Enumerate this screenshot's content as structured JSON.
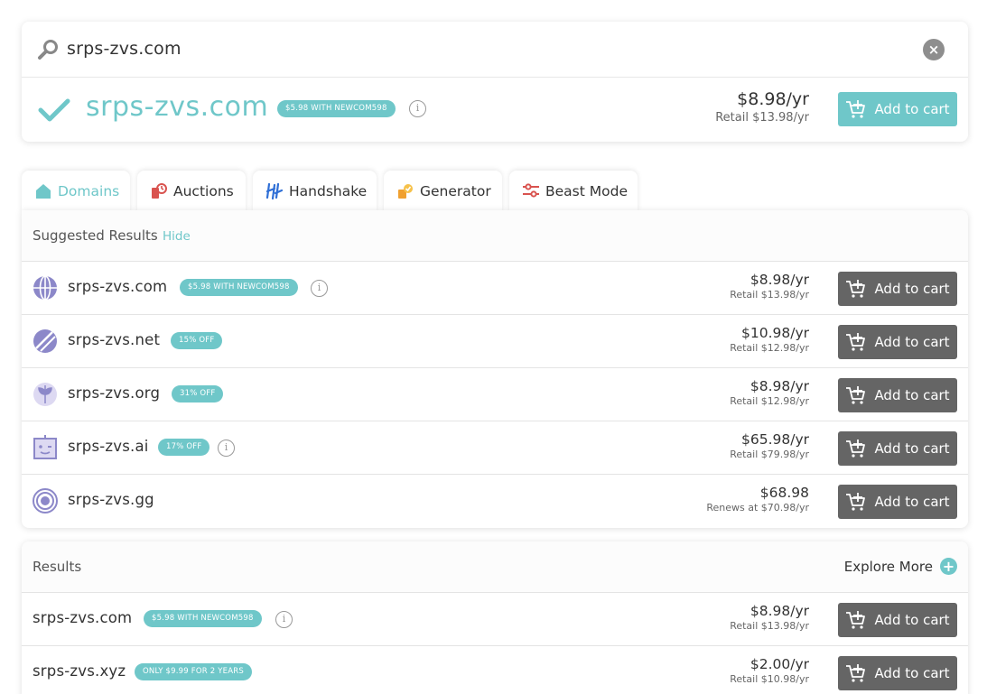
{
  "search": {
    "query": "srps-zvs.com",
    "clear_label": "×"
  },
  "hero": {
    "domain": "srps-zvs.com",
    "badge": "$5.98 WITH NEWCOM598",
    "price": "$8.98/yr",
    "retail": "Retail $13.98/yr",
    "cart_label": "Add to cart"
  },
  "tabs": [
    {
      "label": "Domains",
      "icon": "home-icon"
    },
    {
      "label": "Auctions",
      "icon": "auction-icon"
    },
    {
      "label": "Handshake",
      "icon": "handshake-icon"
    },
    {
      "label": "Generator",
      "icon": "generator-icon"
    },
    {
      "label": "Beast Mode",
      "icon": "sliders-icon"
    }
  ],
  "suggested": {
    "title": "Suggested Results",
    "hide_label": "Hide",
    "rows": [
      {
        "domain": "srps-zvs.com",
        "badge": "$5.98 WITH NEWCOM598",
        "price": "$8.98/yr",
        "retail": "Retail $13.98/yr",
        "cart": "Add to cart",
        "icon": "globe-icon"
      },
      {
        "domain": "srps-zvs.net",
        "badge": "15% OFF",
        "price": "$10.98/yr",
        "retail": "Retail $12.98/yr",
        "cart": "Add to cart",
        "icon": "net-icon"
      },
      {
        "domain": "srps-zvs.org",
        "badge": "31% OFF",
        "price": "$8.98/yr",
        "retail": "Retail $12.98/yr",
        "cart": "Add to cart",
        "icon": "org-icon"
      },
      {
        "domain": "srps-zvs.ai",
        "badge": "17% OFF",
        "price": "$65.98/yr",
        "retail": "Retail $79.98/yr",
        "cart": "Add to cart",
        "icon": "robot-icon"
      },
      {
        "domain": "srps-zvs.gg",
        "price": "$68.98",
        "retail": "Renews at $70.98/yr",
        "cart": "Add to cart",
        "icon": "target-icon"
      }
    ]
  },
  "results": {
    "title": "Results",
    "explore_label": "Explore More",
    "rows": [
      {
        "domain": "srps-zvs.com",
        "badge": "$5.98 WITH NEWCOM598",
        "price": "$8.98/yr",
        "retail": "Retail $13.98/yr",
        "cart": "Add to cart"
      },
      {
        "domain": "srps-zvs.xyz",
        "badge": "ONLY $9.99 FOR 2 YEARS",
        "price": "$2.00/yr",
        "retail": "Retail $10.98/yr",
        "cart": "Add to cart"
      }
    ]
  },
  "colors": {
    "accent": "#6fc7c9",
    "button_dark": "#656565"
  }
}
